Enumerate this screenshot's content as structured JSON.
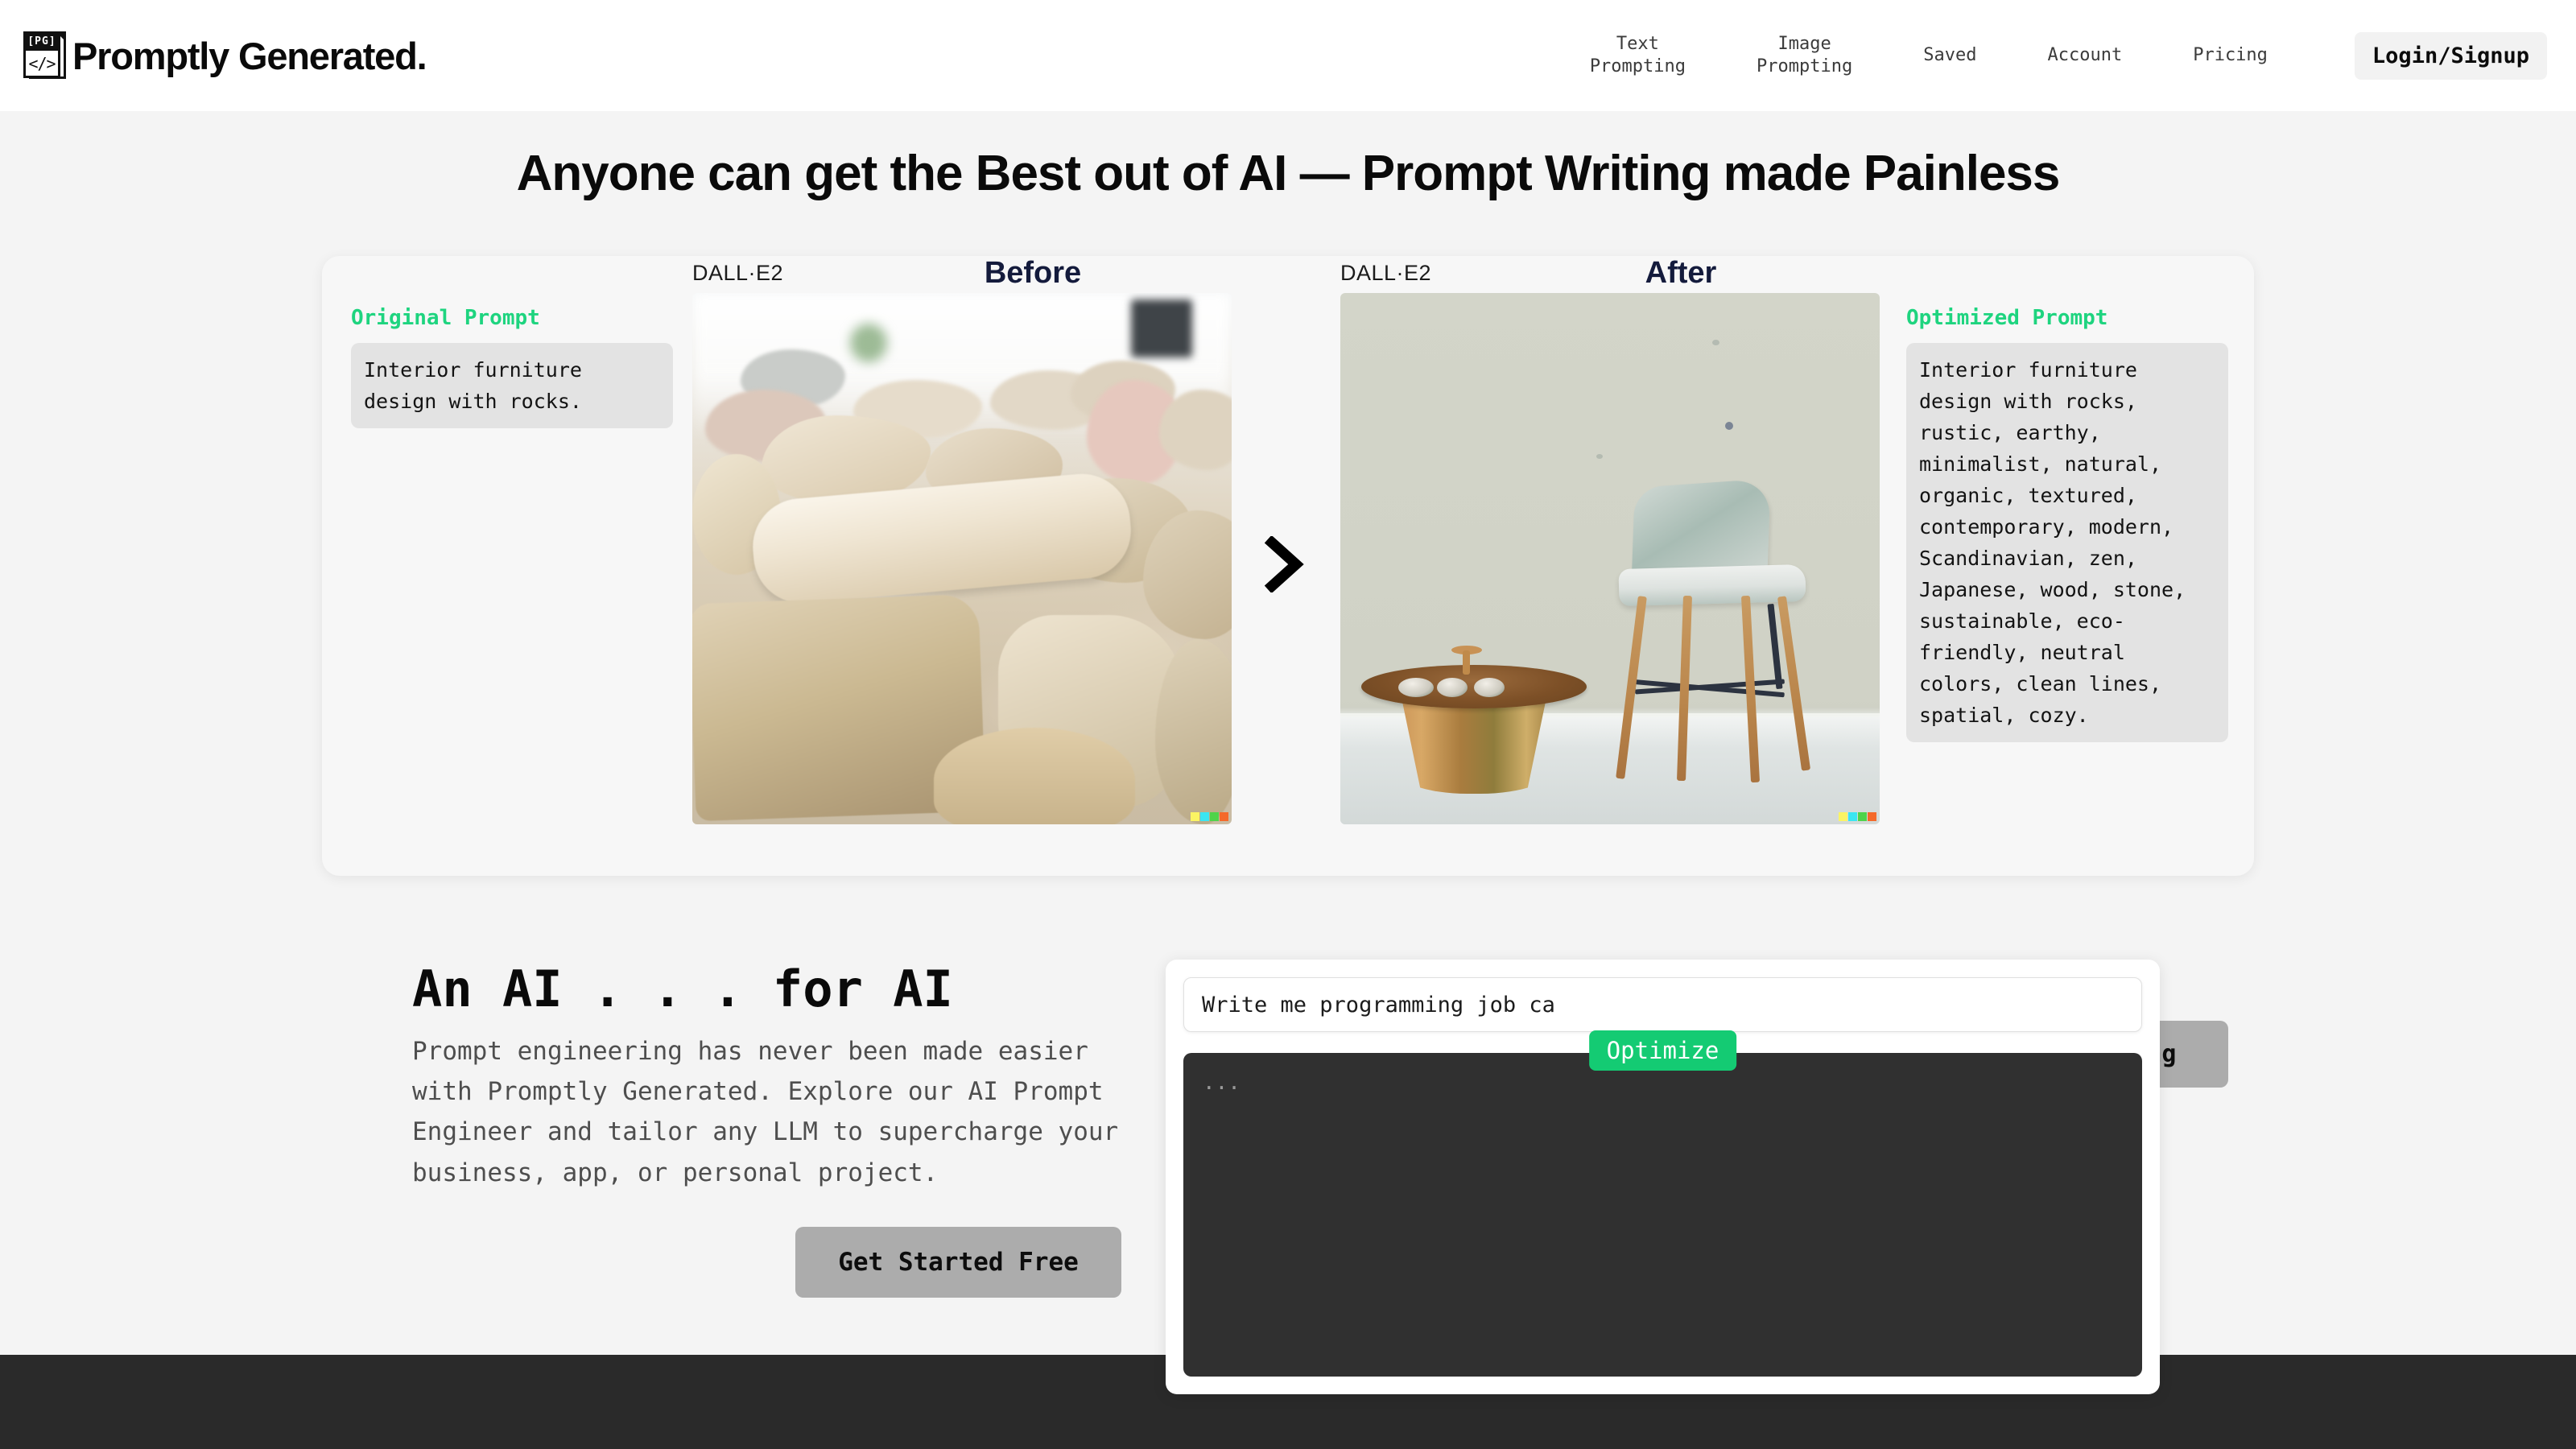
{
  "brand": {
    "name": "Promptly Generated.",
    "logo_badge": "[PG]",
    "logo_code": "</>"
  },
  "nav": {
    "items": [
      {
        "label": "Text\nPrompting"
      },
      {
        "label": "Image\nPrompting"
      },
      {
        "label": "Saved"
      },
      {
        "label": "Account"
      },
      {
        "label": "Pricing"
      }
    ],
    "login_label": "Login/Signup"
  },
  "hero": {
    "title": "Anyone can get the Best out of AI —  Prompt Writing made Painless"
  },
  "compare": {
    "original_label": "Original Prompt",
    "original_prompt": "Interior furniture design with rocks.",
    "optimized_label": "Optimized Prompt",
    "optimized_prompt": "Interior furniture design with rocks, rustic, earthy, minimalist, natural, organic, textured, contemporary, modern, Scandinavian, zen, Japanese, wood, stone, sustainable, eco-friendly, neutral colors, clean lines, spatial, cozy.",
    "before_label": "Before",
    "after_label": "After",
    "dalle_tag_before": "DALL·E2",
    "dalle_tag_after": "DALL·E2",
    "image_prompting_button": "Image Prompting",
    "arrow_icon": "chevron-right"
  },
  "lower": {
    "heading": "An AI . . . for AI",
    "paragraph": "Prompt engineering has never been made easier with Promptly Generated. Explore our AI Prompt Engineer and tailor any LLM to supercharge your business, app, or personal project.",
    "cta_label": "Get Started Free"
  },
  "demo": {
    "input_value": "Write me programming job ca",
    "input_placeholder": "Write me programming job ca",
    "optimize_label": "Optimize",
    "output_text": "..."
  },
  "colors": {
    "accent_green": "#14cb73",
    "label_green": "#1ed47f",
    "navy": "#141b3c",
    "page_bg": "#f4f4f4",
    "card_bg": "#f7f7f7",
    "prompt_box_bg": "#e3e3e3",
    "button_grey": "#acacac",
    "footer_dark": "#2a2a2a",
    "output_dark": "#303030",
    "watermark": [
      "#fbf463",
      "#3ae6f2",
      "#4fd34a",
      "#f4692a"
    ]
  }
}
